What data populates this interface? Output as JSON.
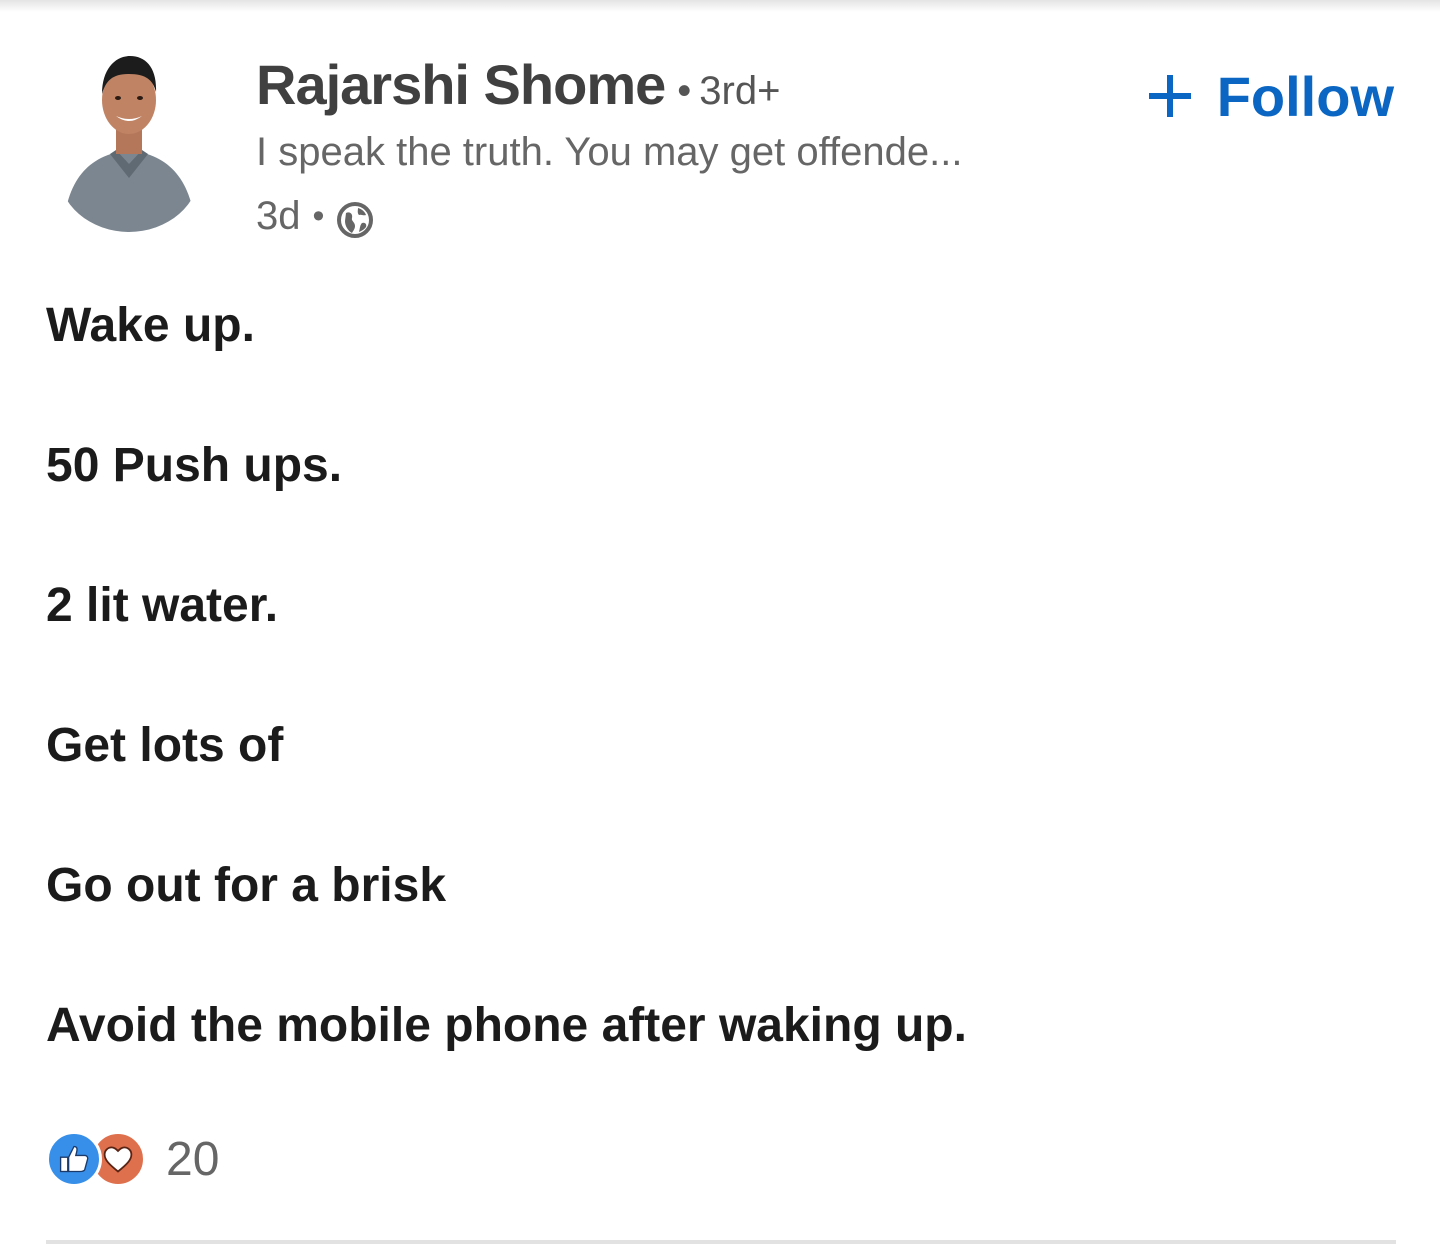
{
  "author": {
    "name": "Rajarshi Shome",
    "degree": "3rd+",
    "separator": "•",
    "headline": "I speak the truth. You may get offende...",
    "time": "3d",
    "visibility_icon": "globe-icon"
  },
  "follow": {
    "label": "Follow",
    "icon": "plus-icon",
    "color": "#0a66c2"
  },
  "post": {
    "lines": [
      "Wake up.",
      "50 Push ups.",
      "2 lit water.",
      "Get lots of",
      "Go out for a brisk",
      "Avoid the mobile phone after waking up."
    ]
  },
  "reactions": {
    "icons": [
      "like-icon",
      "love-icon"
    ],
    "count": "20",
    "like_color": "#378fe9",
    "love_color": "#df704d"
  }
}
